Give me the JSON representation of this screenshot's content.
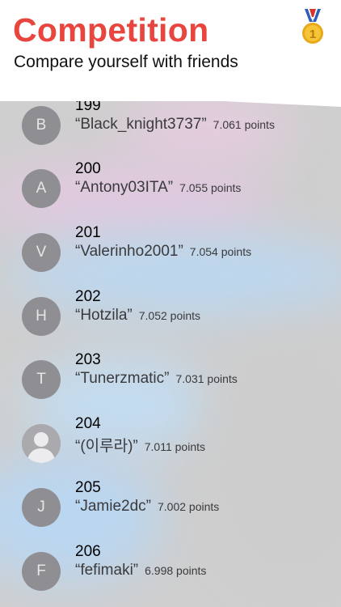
{
  "header": {
    "title": "Competition",
    "subtitle": "Compare yourself with friends"
  },
  "medal": {
    "icon": "gold-medal-icon",
    "label": "1"
  },
  "leaderboard": [
    {
      "rank": "199",
      "initial": "B",
      "username": "“Black_knight3737”",
      "points": "7.061 points"
    },
    {
      "rank": "200",
      "initial": "A",
      "username": "“Antony03ITA”",
      "points": "7.055 points"
    },
    {
      "rank": "201",
      "initial": "V",
      "username": "“Valerinho2001”",
      "points": "7.054 points"
    },
    {
      "rank": "202",
      "initial": "H",
      "username": "“Hotzila”",
      "points": "7.052 points"
    },
    {
      "rank": "203",
      "initial": "T",
      "username": "“Tunerzmatic”",
      "points": "7.031 points"
    },
    {
      "rank": "204",
      "initial": "",
      "avatar_icon": "person-silhouette-icon",
      "username": "“(이루라)”",
      "points": "7.011 points"
    },
    {
      "rank": "205",
      "initial": "J",
      "username": "“Jamie2dc”",
      "points": "7.002 points"
    },
    {
      "rank": "206",
      "initial": "F",
      "username": "“fefimaki”",
      "points": "6.998 points"
    }
  ],
  "colors": {
    "accent": "#e8453e",
    "avatar": "#8e8e93",
    "panel": "#cfcfcf"
  }
}
